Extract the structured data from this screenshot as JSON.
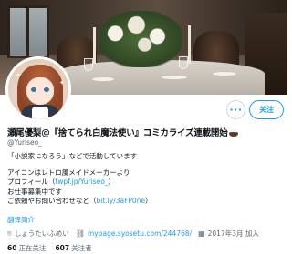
{
  "profile": {
    "display_name": "瀬尾優梨@『捨てられ白魔法使い』コミカライズ連載開始",
    "name_emoji": "coffee-icon",
    "handle": "@Yuriseo_",
    "bio": {
      "line1": "「小説家になろう」などで活動しています",
      "line2": "アイコンはレトロ風メイドメーカーより",
      "line3_prefix": "プロフィール（",
      "line3_link": "twpf.jp/Yuriseo_",
      "line3_suffix": "）",
      "line4": "お仕事募集中です",
      "line5_prefix": "ご依頼やお問い合わせなど（",
      "line5_link": "bit.ly/3aFP0ne",
      "line5_suffix": "）"
    },
    "translate_label": "翻译简介",
    "location": "しょうたいふめい",
    "website": "mypage.syosetu.com/244768/",
    "joined": "2017年3月 加入",
    "following_count": "60",
    "following_label": "正在关注",
    "followers_count": "607",
    "followers_label": "关注者"
  },
  "actions": {
    "more_label": "···",
    "follow_label": "关注"
  },
  "icons": {
    "more": "more-icon",
    "location": "location-pin-icon",
    "link": "link-icon",
    "calendar": "calendar-icon"
  },
  "colors": {
    "accent": "#1d9bf0",
    "text": "#0f1419",
    "secondary": "#536471"
  }
}
